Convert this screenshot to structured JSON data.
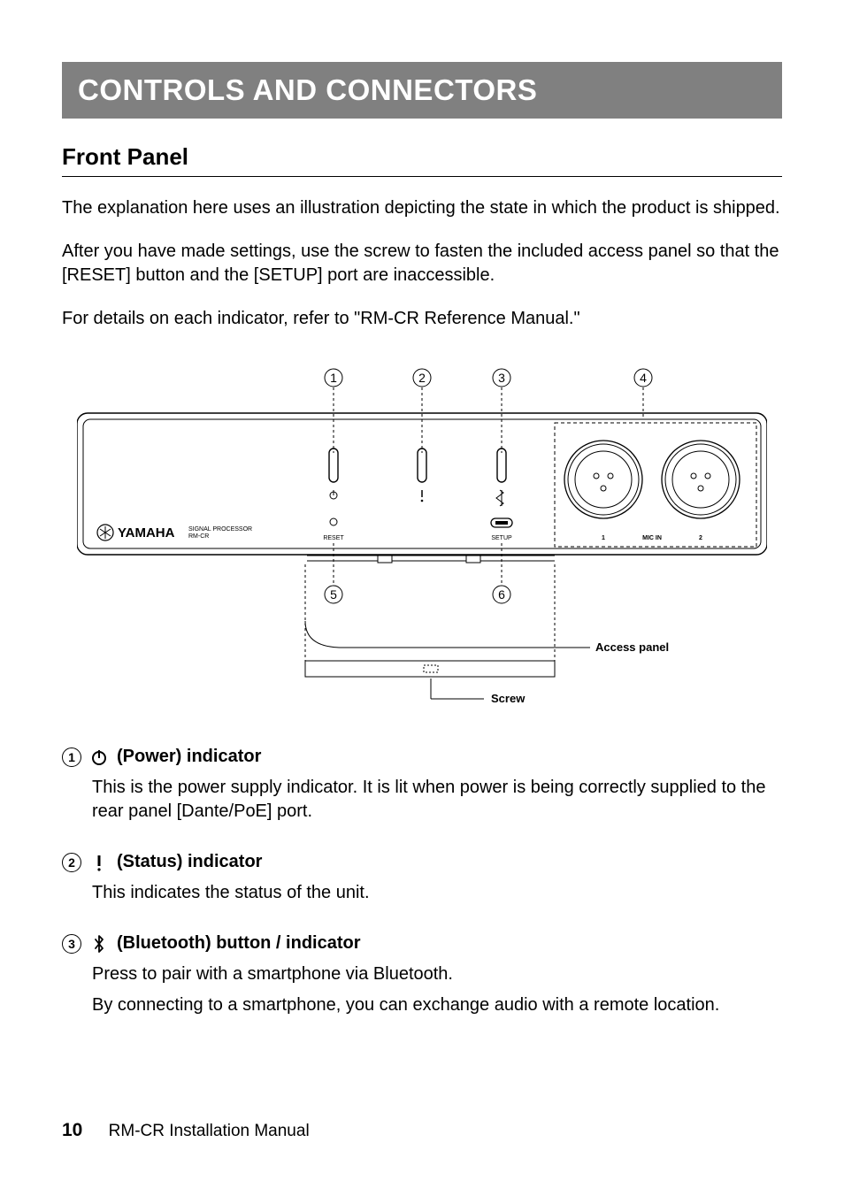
{
  "header": "CONTROLS AND CONNECTORS",
  "section": "Front Panel",
  "para1": "The explanation here uses an illustration depicting the state in which the product is shipped.",
  "para2": "After you have made settings, use the screw to fasten the included access panel so that the [RESET] button and the [SETUP] port are inaccessible.",
  "para3": "For details on each indicator, refer to \"RM-CR Reference Manual.\"",
  "diagram": {
    "callouts": {
      "c1": "1",
      "c2": "2",
      "c3": "3",
      "c4": "4",
      "c5": "5",
      "c6": "6"
    },
    "labels": {
      "brand": "YAMAHA",
      "model_top": "SIGNAL PROCESSOR",
      "model_bottom": "RM-CR",
      "reset": "RESET",
      "setup": "SETUP",
      "mic1": "1",
      "micin": "MIC IN",
      "mic2": "2",
      "access_panel": "Access panel",
      "screw": "Screw"
    }
  },
  "items": [
    {
      "num": "1",
      "icon": "power-icon",
      "title": "(Power) indicator",
      "desc": [
        "This is the power supply indicator. It is lit when power is being correctly supplied to the rear panel [Dante/PoE] port."
      ]
    },
    {
      "num": "2",
      "icon": "status-icon",
      "title": "(Status) indicator",
      "desc": [
        "This indicates the status of the unit."
      ]
    },
    {
      "num": "3",
      "icon": "bluetooth-icon",
      "title": "(Bluetooth) button / indicator",
      "desc": [
        "Press to pair with a smartphone via Bluetooth.",
        "By connecting to a smartphone, you can exchange audio with a remote location."
      ]
    }
  ],
  "footer": {
    "page": "10",
    "title": "RM-CR Installation Manual"
  }
}
